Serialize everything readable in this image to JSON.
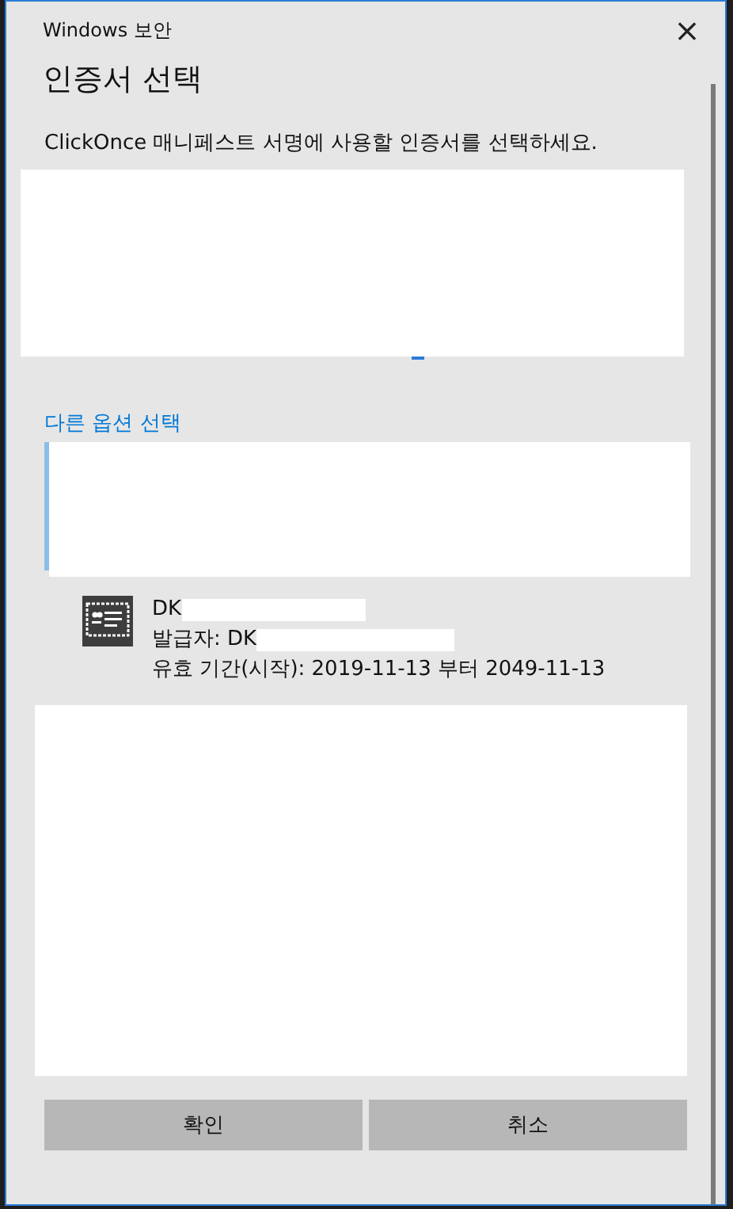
{
  "window": {
    "title": "Windows 보안",
    "close": "×"
  },
  "heading": "인증서 선택",
  "instruction": "ClickOnce 매니페스트 서명에 사용할 인증서를 선택하세요.",
  "more_options_link": "다른 옵션 선택",
  "certificate": {
    "name": "DK",
    "issuer": "발급자: DK",
    "validity": "유효 기간(시작): 2019-11-13 부터 2049-11-13"
  },
  "buttons": [
    {
      "label": "확인"
    },
    {
      "label": "취소"
    }
  ]
}
